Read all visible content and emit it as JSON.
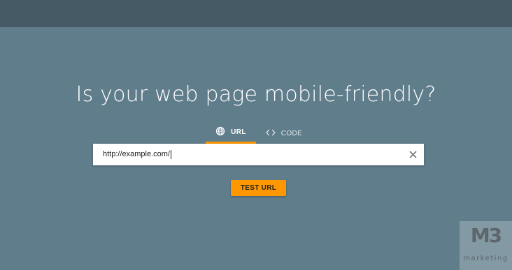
{
  "colors": {
    "page_background": "#607d8b",
    "top_bar": "#455a64",
    "accent": "#ff9800",
    "input_background": "#ffffff"
  },
  "header": {
    "headline": "Is your web page mobile-friendly?"
  },
  "tabs": [
    {
      "label": "URL",
      "icon": "globe-icon",
      "selected": true
    },
    {
      "label": "CODE",
      "icon": "code-icon",
      "selected": false
    }
  ],
  "url_input": {
    "value": "http://example.com/",
    "clear_icon": "close-icon"
  },
  "actions": {
    "test_button_label": "TEST URL"
  },
  "watermark": {
    "logo_text": "M3",
    "subtitle": "marketing"
  }
}
